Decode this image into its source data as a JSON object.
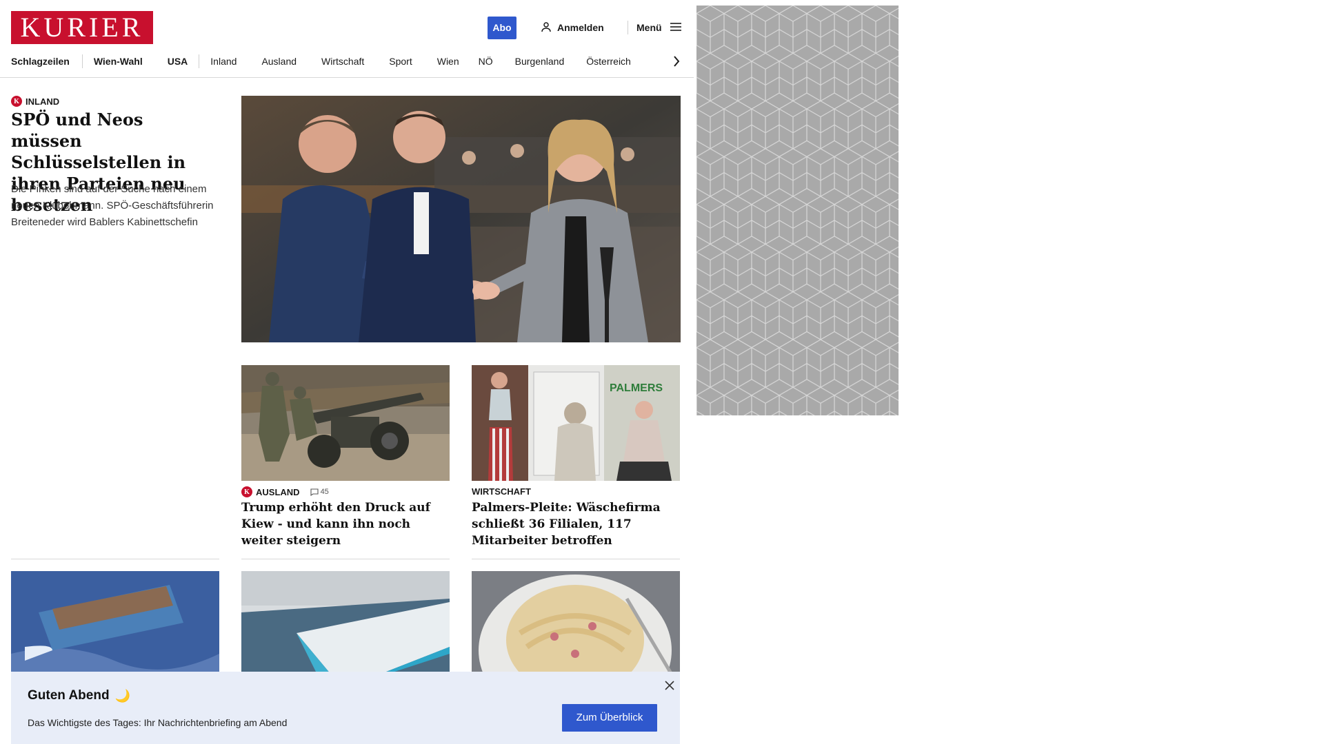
{
  "header": {
    "logo_text": "KURIER",
    "abo_label": "Abo",
    "login_label": "Anmelden",
    "menu_label": "Menü",
    "brand_color": "#c8102e",
    "accent_color": "#2f58cd"
  },
  "nav": {
    "items": [
      "Schlagzeilen",
      "Wien-Wahl",
      "USA",
      "Inland",
      "Ausland",
      "Wirtschaft",
      "Sport",
      "Wien",
      "NÖ",
      "Burgenland",
      "Österreich"
    ]
  },
  "lead": {
    "kicker": "INLAND",
    "title": "SPÖ und Neos müssen Schlüsselstellen in ihren Parteien neu besetzen",
    "teaser": "Die Pinken sind auf der Suche nach einem neuen Klubobmann. SPÖ-Geschäftsführerin Breiteneder wird Bablers Kabinettschefin",
    "badge": "K"
  },
  "cards": [
    {
      "kicker": "AUSLAND",
      "badge": "K",
      "comments": "45",
      "title": "Trump erhöht den Druck auf Kiew - und kann ihn noch weiter steigern"
    },
    {
      "kicker": "WIRTSCHAFT",
      "title": "Palmers-Pleite: Wäschefirma schließt 36 Filialen, 117 Mitarbeiter betroffen",
      "sign_text": "PALMERS"
    }
  ],
  "briefing": {
    "title": "Guten Abend",
    "moon": "🌙",
    "text": "Das Wichtigste des Tages: Ihr Nachrichtenbriefing am Abend",
    "button_label": "Zum Überblick"
  }
}
